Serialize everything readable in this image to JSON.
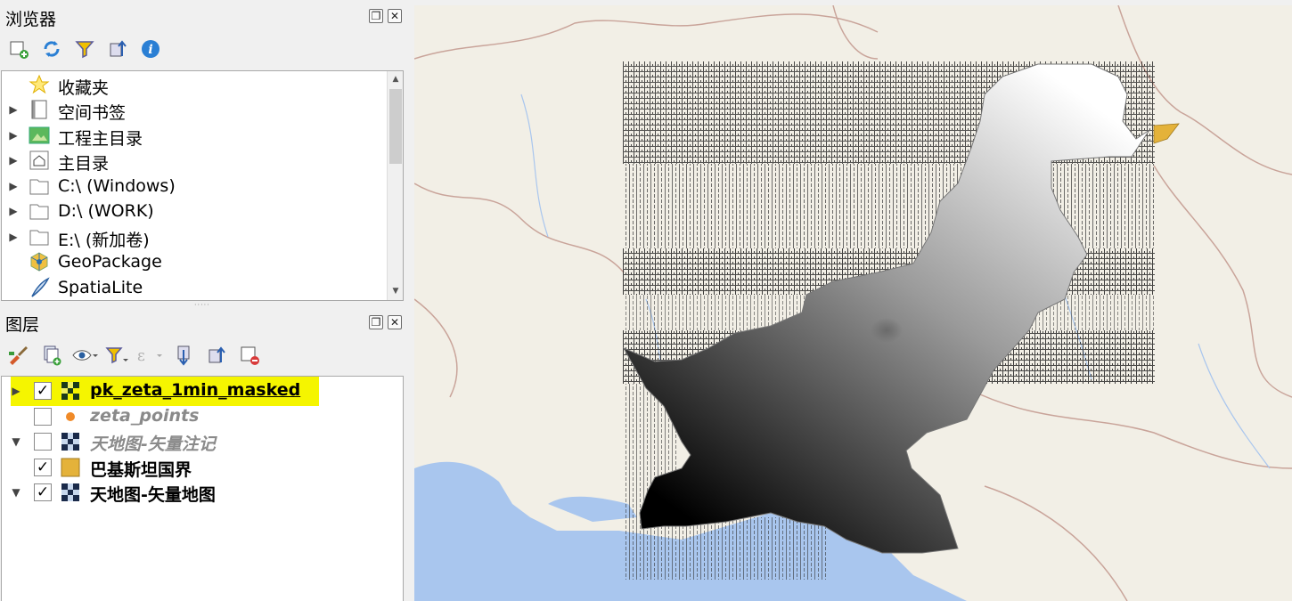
{
  "browser_panel": {
    "title": "浏览器",
    "toolbar": [
      {
        "name": "add-selected-layers-icon",
        "tooltip": ""
      },
      {
        "name": "refresh-icon"
      },
      {
        "name": "filter-icon"
      },
      {
        "name": "collapse-all-icon"
      },
      {
        "name": "info-icon"
      }
    ],
    "items": [
      {
        "label": "收藏夹",
        "icon": "star-icon",
        "expandable": false
      },
      {
        "label": "空间书签",
        "icon": "bookmark-icon",
        "expandable": true
      },
      {
        "label": "工程主目录",
        "icon": "project-home-icon",
        "expandable": true
      },
      {
        "label": "主目录",
        "icon": "home-icon",
        "expandable": true
      },
      {
        "label": "C:\\ (Windows)",
        "icon": "folder-icon",
        "expandable": true
      },
      {
        "label": "D:\\ (WORK)",
        "icon": "folder-icon",
        "expandable": true
      },
      {
        "label": "E:\\ (新加卷)",
        "icon": "folder-icon",
        "expandable": true
      },
      {
        "label": "GeoPackage",
        "icon": "geopackage-icon",
        "expandable": false
      },
      {
        "label": "SpatiaLite",
        "icon": "spatialite-icon",
        "expandable": false
      }
    ]
  },
  "layers_panel": {
    "title": "图层",
    "layers": [
      {
        "label": "pk_zeta_1min_masked",
        "checked": true,
        "expandable": true,
        "expanded": false,
        "type": "raster",
        "selected": true,
        "italic": false
      },
      {
        "label": "zeta_points",
        "checked": false,
        "expandable": false,
        "type": "point",
        "selected": false,
        "italic": true
      },
      {
        "label": "天地图-矢量注记",
        "checked": false,
        "expandable": true,
        "expanded": true,
        "type": "raster",
        "selected": false,
        "italic": true
      },
      {
        "label": "巴基斯坦国界",
        "checked": true,
        "expandable": false,
        "type": "polygon",
        "selected": false,
        "italic": false
      },
      {
        "label": "天地图-矢量地图",
        "checked": true,
        "expandable": true,
        "expanded": true,
        "type": "raster",
        "selected": false,
        "italic": false
      }
    ],
    "highlight_color": "#f5f500"
  },
  "colors": {
    "polygon_fill": "#e4b23a",
    "sea": "#a9c6ee",
    "land": "#f2efe6",
    "border": "#c9a49a"
  }
}
